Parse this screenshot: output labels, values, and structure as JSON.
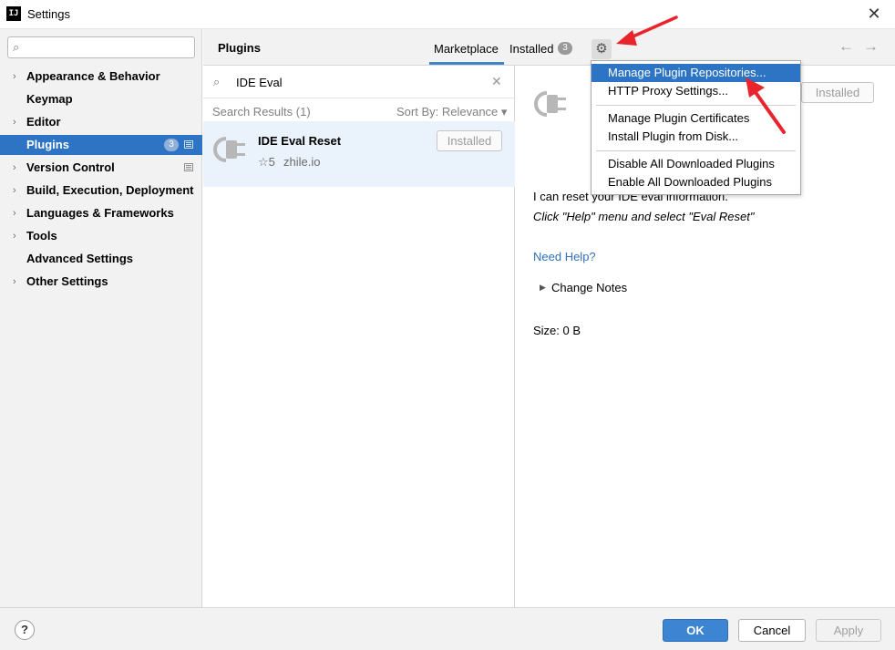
{
  "window": {
    "title": "Settings",
    "logo_text": "IJ"
  },
  "sidebar": {
    "items": [
      {
        "label": "Appearance & Behavior",
        "chevron": true
      },
      {
        "label": "Keymap",
        "chevron": false
      },
      {
        "label": "Editor",
        "chevron": true
      },
      {
        "label": "Plugins",
        "chevron": false,
        "active": true,
        "badge": "3"
      },
      {
        "label": "Version Control",
        "chevron": true
      },
      {
        "label": "Build, Execution, Deployment",
        "chevron": true
      },
      {
        "label": "Languages & Frameworks",
        "chevron": true
      },
      {
        "label": "Tools",
        "chevron": true
      },
      {
        "label": "Advanced Settings",
        "chevron": false
      },
      {
        "label": "Other Settings",
        "chevron": true
      }
    ]
  },
  "header": {
    "title": "Plugins",
    "tab_marketplace": "Marketplace",
    "tab_installed": "Installed",
    "installed_count": "3"
  },
  "search": {
    "value": "IDE Eval"
  },
  "results": {
    "header": "Search Results (1)",
    "sort": "Sort By: Relevance ▾",
    "item": {
      "name": "IDE Eval Reset",
      "rating": "☆5",
      "vendor": "zhile.io",
      "button": "Installed"
    }
  },
  "details": {
    "installed_button": "Installed",
    "description": "I can reset your IDE eval information.",
    "instructions": "Click \"Help\" menu and select \"Eval Reset\"",
    "help_link": "Need Help?",
    "change_notes": "Change Notes",
    "size": "Size: 0 B"
  },
  "menu": {
    "items": [
      "Manage Plugin Repositories...",
      "HTTP Proxy Settings...",
      "Manage Plugin Certificates",
      "Install Plugin from Disk...",
      "Disable All Downloaded Plugins",
      "Enable All Downloaded Plugins"
    ]
  },
  "footer": {
    "ok": "OK",
    "cancel": "Cancel",
    "apply": "Apply",
    "help": "?"
  },
  "colors": {
    "accent": "#2d74c4",
    "ok_button": "#3d84d2",
    "link": "#2f6fbe",
    "annotation_arrow": "#e8242c"
  },
  "icons": {
    "search": "magnifier-icon",
    "gear": "gear-icon",
    "close": "close-icon",
    "plugin": "plug-icon"
  }
}
